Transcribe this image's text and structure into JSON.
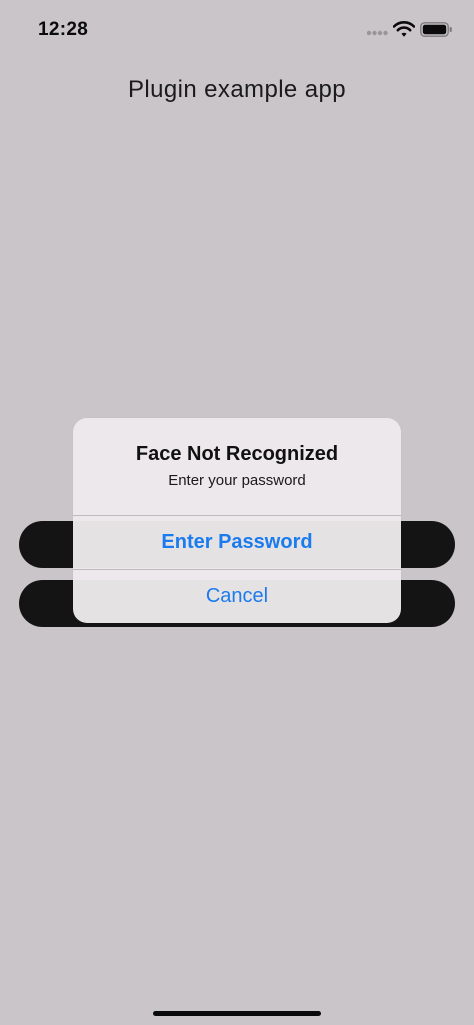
{
  "status_bar": {
    "time": "12:28",
    "icons": [
      "signal-icon",
      "wifi-icon",
      "battery-icon"
    ]
  },
  "app": {
    "title": "Plugin example app"
  },
  "alert": {
    "title": "Face Not Recognized",
    "message": "Enter your password",
    "actions": {
      "primary_label": "Enter Password",
      "cancel_label": "Cancel"
    }
  },
  "colors": {
    "background": "#cac5c8",
    "accent": "#1a7bef",
    "dark_button": "#141414",
    "alert_background": "#ece9eb"
  }
}
